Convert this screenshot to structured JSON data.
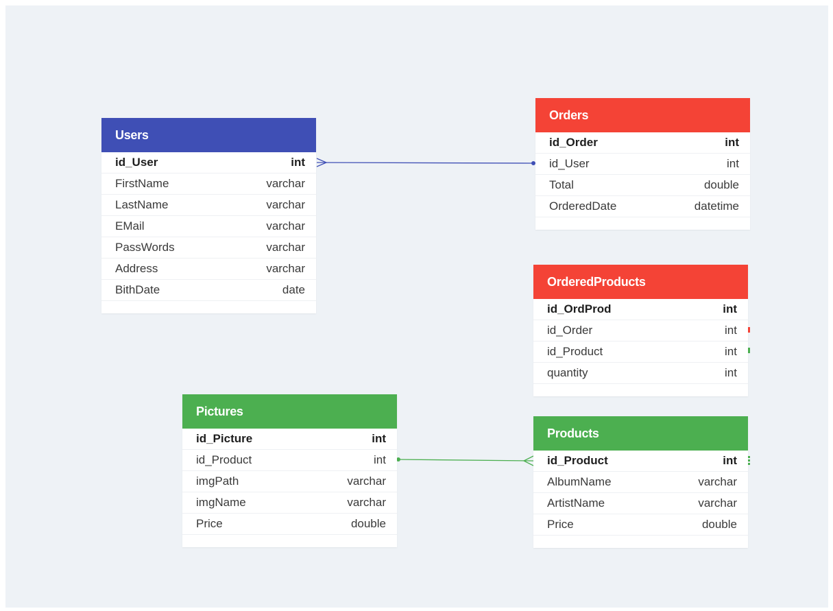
{
  "colors": {
    "canvas": "#eef2f6",
    "users_header": "#3f4fb5",
    "red_header": "#f44336",
    "green_header": "#4caf50",
    "users_link": "#3f4fb5",
    "pictures_link": "#4caf50"
  },
  "tables": {
    "users": {
      "title": "Users",
      "rows": [
        {
          "name": "id_User",
          "type": "int"
        },
        {
          "name": "FirstName",
          "type": "varchar"
        },
        {
          "name": "LastName",
          "type": "varchar"
        },
        {
          "name": "EMail",
          "type": "varchar"
        },
        {
          "name": "PassWords",
          "type": "varchar"
        },
        {
          "name": "Address",
          "type": "varchar"
        },
        {
          "name": "BithDate",
          "type": "date"
        }
      ]
    },
    "orders": {
      "title": "Orders",
      "rows": [
        {
          "name": "id_Order",
          "type": "int"
        },
        {
          "name": "id_User",
          "type": "int"
        },
        {
          "name": "Total",
          "type": "double"
        },
        {
          "name": "OrderedDate",
          "type": "datetime"
        }
      ]
    },
    "ordered_products": {
      "title": "OrderedProducts",
      "rows": [
        {
          "name": "id_OrdProd",
          "type": "int"
        },
        {
          "name": "id_Order",
          "type": "int"
        },
        {
          "name": "id_Product",
          "type": "int"
        },
        {
          "name": "quantity",
          "type": "int"
        }
      ]
    },
    "pictures": {
      "title": "Pictures",
      "rows": [
        {
          "name": "id_Picture",
          "type": "int"
        },
        {
          "name": "id_Product",
          "type": "int"
        },
        {
          "name": "imgPath",
          "type": "varchar"
        },
        {
          "name": "imgName",
          "type": "varchar"
        },
        {
          "name": "Price",
          "type": "double"
        }
      ]
    },
    "products": {
      "title": "Products",
      "rows": [
        {
          "name": "id_Product",
          "type": "int"
        },
        {
          "name": "AlbumName",
          "type": "varchar"
        },
        {
          "name": "ArtistName",
          "type": "varchar"
        },
        {
          "name": "Price",
          "type": "double"
        }
      ]
    }
  },
  "relations": [
    {
      "from": "Users.id_User",
      "to": "Orders.id_User",
      "from_end": "many",
      "to_end": "one"
    },
    {
      "from": "Pictures.id_Product",
      "to": "Products.id_Product",
      "from_end": "one",
      "to_end": "many"
    }
  ]
}
